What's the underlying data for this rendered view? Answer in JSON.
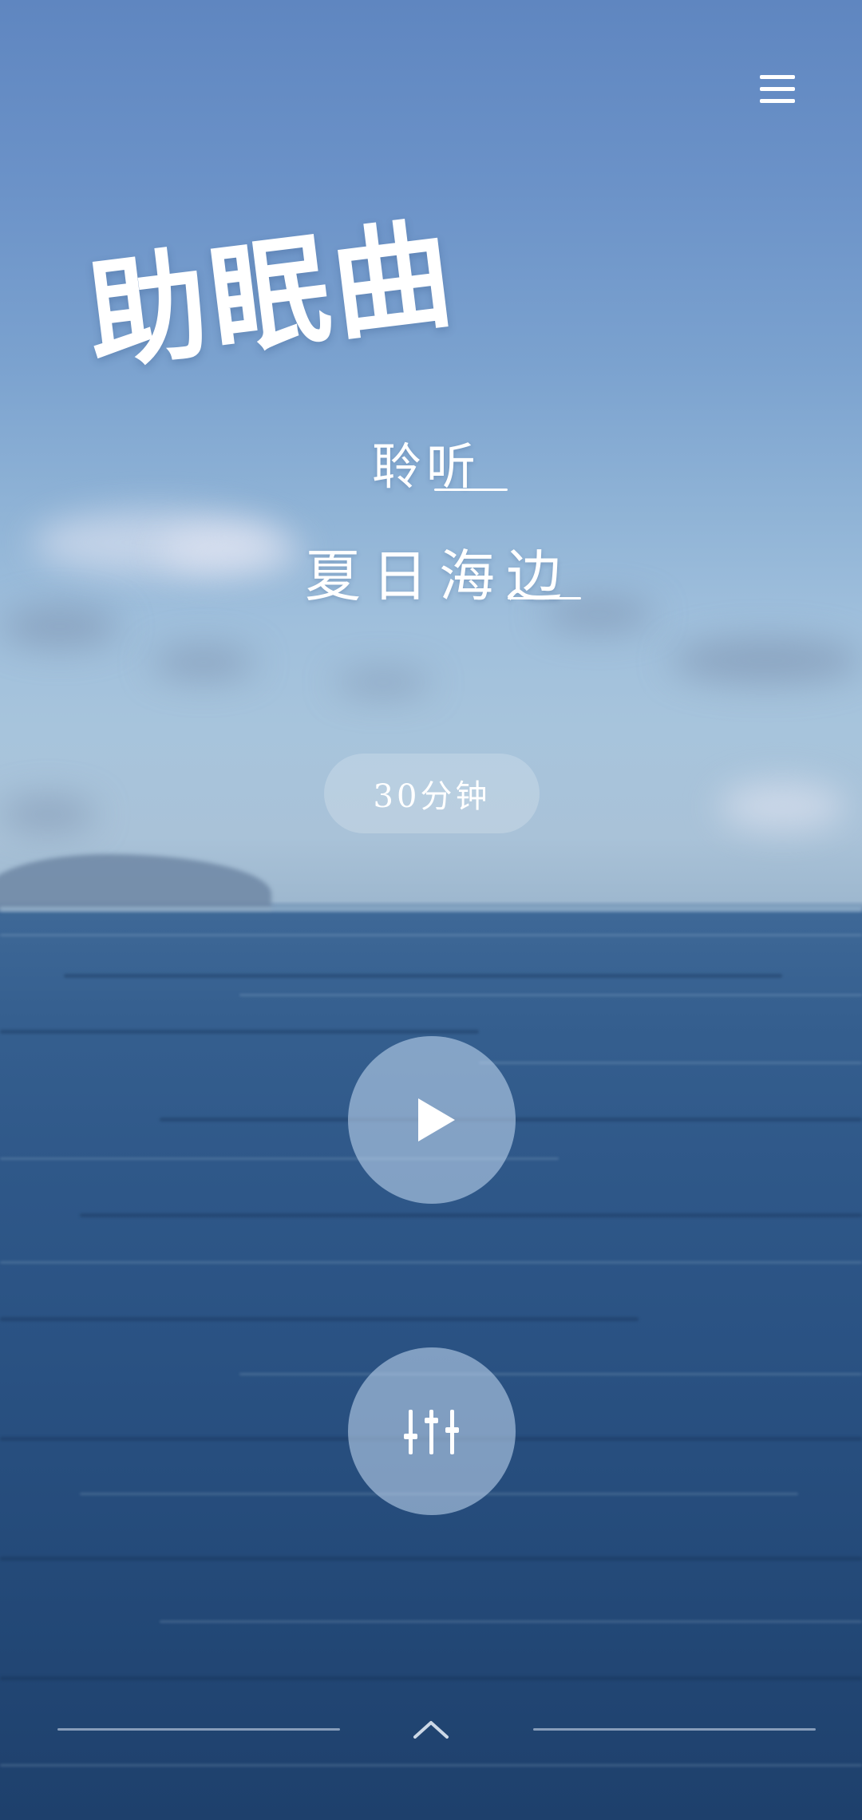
{
  "app": {
    "title": "助眠曲",
    "subtitle_line1": "聆听",
    "subtitle_line2": "夏日海边"
  },
  "duration": {
    "label": "30分钟"
  },
  "controls": {
    "play_icon": "play-icon",
    "mixer_icon": "equalizer-sliders-icon",
    "menu_icon": "hamburger-menu-icon",
    "expand_icon": "chevron-up-icon"
  },
  "colors": {
    "sky_top": "#5f86c0",
    "sky_bottom": "#a9c2d8",
    "sea_top": "#3e6897",
    "sea_bottom": "#1e406c",
    "text": "#ffffff"
  }
}
